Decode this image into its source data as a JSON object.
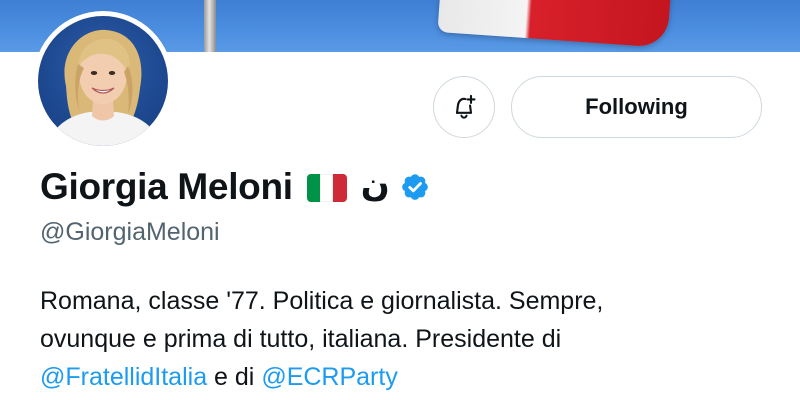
{
  "profile": {
    "display_name": "Giorgia Meloni",
    "flag_icon": "italy-flag-icon",
    "arabic_character": "ن",
    "verified_icon": "verified-badge-icon",
    "handle": "@GiorgiaMeloni"
  },
  "actions": {
    "notify_icon": "bell-plus-icon",
    "following_label": "Following"
  },
  "bio": {
    "line1": "Romana, classe '77. Politica e giornalista. Sempre,",
    "line2": "ovunque e prima di tutto, italiana. Presidente di",
    "mention1": "@FratellidItalia",
    "connector": " e di ",
    "mention2": "@ECRParty"
  },
  "colors": {
    "link": "#1d9bf0",
    "verified": "#1d9bf0",
    "secondary_text": "#536471",
    "button_border": "#cfd9de",
    "flag_green": "#009246",
    "flag_white": "#ffffff",
    "flag_red": "#ce2b37"
  }
}
